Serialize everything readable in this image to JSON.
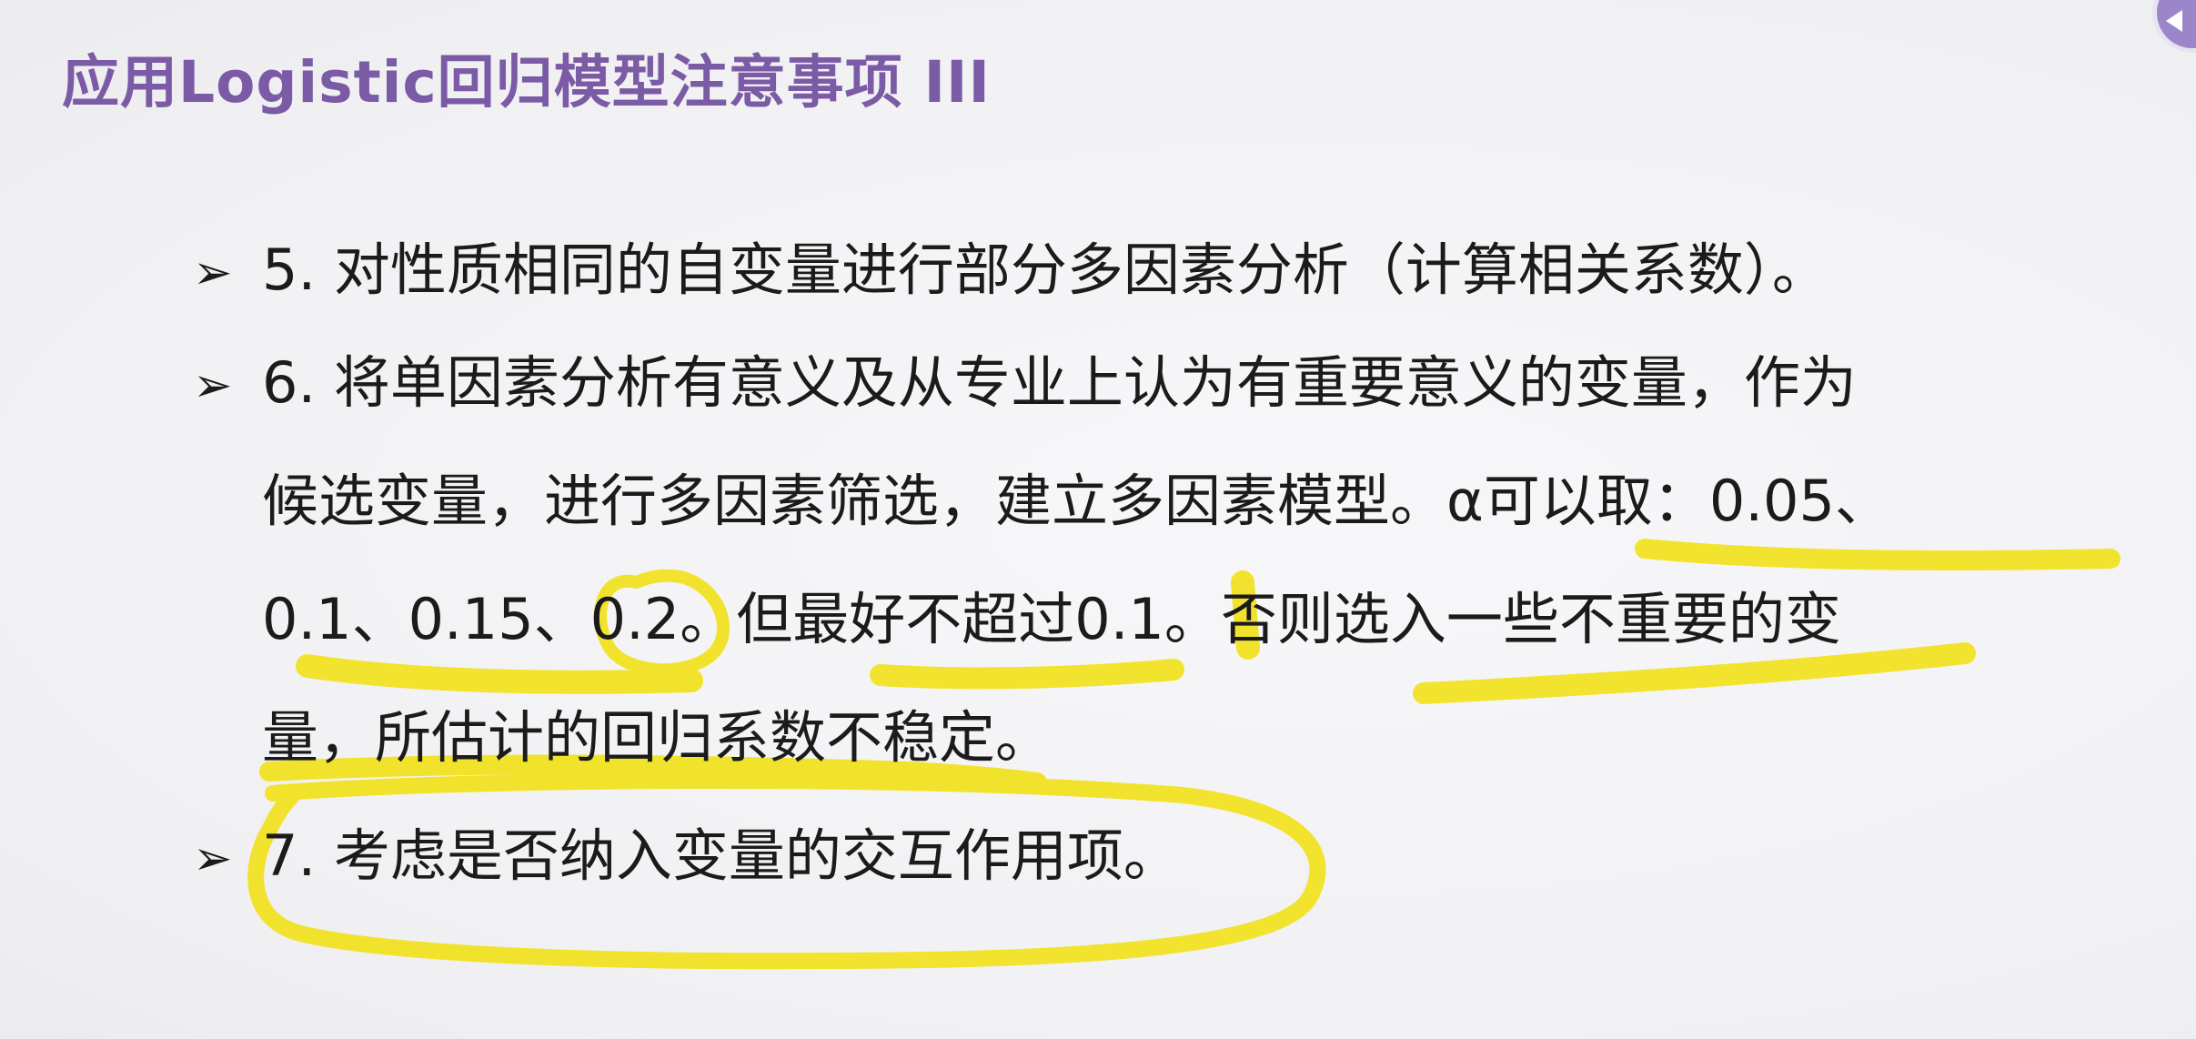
{
  "slide": {
    "title": "应用Logistic回归模型注意事项 III",
    "bullet_marker": "➢",
    "items": [
      {
        "lines": [
          "5. 对性质相同的自变量进行部分多因素分析（计算相关系数）。"
        ]
      },
      {
        "lines": [
          "6. 将单因素分析有意义及从专业上认为有重要意义的变量，作为",
          "候选变量，进行多因素筛选，建立多因素模型。α可以取：0.05、",
          "0.1、0.15、0.2。但最好不超过0.1。否则选入一些不重要的变",
          "量，所估计的回归系数不稳定。"
        ]
      },
      {
        "lines": [
          "7. 考虑是否纳入变量的交互作用项。"
        ]
      }
    ]
  },
  "annotation": {
    "highlight_color": "#f1e21c"
  }
}
